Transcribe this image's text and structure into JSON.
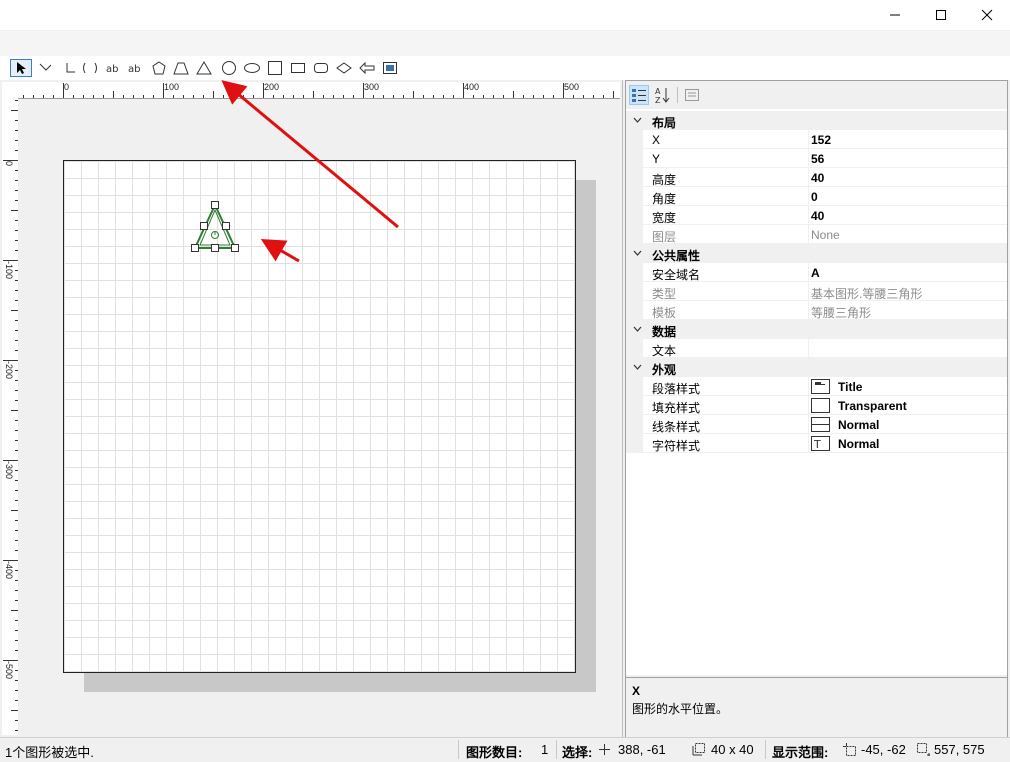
{
  "window": {
    "controls": [
      "minimize-icon",
      "maximize-icon",
      "close-icon"
    ]
  },
  "toolbar": {
    "tools": [
      "select-pointer",
      "connector",
      "polyline",
      "arc",
      "text-label",
      "text-box",
      "pentagon",
      "trapezoid",
      "isosceles-triangle",
      "circle",
      "ellipse",
      "square",
      "rounded-rectangle",
      "diamond",
      "left-arrow",
      "image"
    ]
  },
  "ruler": {
    "horizontal": [
      "0",
      "100",
      "200",
      "300",
      "400",
      "500"
    ],
    "vertical": [
      "0",
      "-100",
      "-200",
      "-300",
      "-400",
      "-500"
    ]
  },
  "properties": {
    "toolbar": [
      "categorized-icon",
      "alphabetical-icon",
      "property-pages-icon"
    ],
    "categories": [
      {
        "name": "布局",
        "items": [
          {
            "name": "X",
            "value": "152"
          },
          {
            "name": "Y",
            "value": "56"
          },
          {
            "name": "高度",
            "value": "40"
          },
          {
            "name": "角度",
            "value": "0"
          },
          {
            "name": "宽度",
            "value": "40"
          },
          {
            "name": "图层",
            "value": "None"
          }
        ]
      },
      {
        "name": "公共属性",
        "items": [
          {
            "name": "安全域名",
            "value": "A"
          },
          {
            "name": "类型",
            "value": "基本图形.等腰三角形"
          },
          {
            "name": "模板",
            "value": "等腰三角形"
          }
        ]
      },
      {
        "name": "数据",
        "items": [
          {
            "name": "文本",
            "value": ""
          }
        ]
      },
      {
        "name": "外观",
        "items": [
          {
            "name": "段落样式",
            "value": "Title"
          },
          {
            "name": "填充样式",
            "value": "Transparent"
          },
          {
            "name": "线条样式",
            "value": "Normal"
          },
          {
            "name": "字符样式",
            "value": "Normal"
          }
        ]
      }
    ],
    "description": {
      "title": "X",
      "text": "图形的水平位置。"
    }
  },
  "statusbar": {
    "message": "1个图形被选中.",
    "count_label": "图形数目:",
    "count_value": "1",
    "selection_label": "选择:",
    "selection_pos": "388,  -61",
    "selection_size": "40 x 40",
    "view_label": "显示范围:",
    "view_origin": "-45, -62",
    "view_extent": "557, 575"
  },
  "colors": {
    "selection": "#2e7d32",
    "annotation_arrow": "#e01010",
    "grid_line": "#e0e0e0"
  }
}
